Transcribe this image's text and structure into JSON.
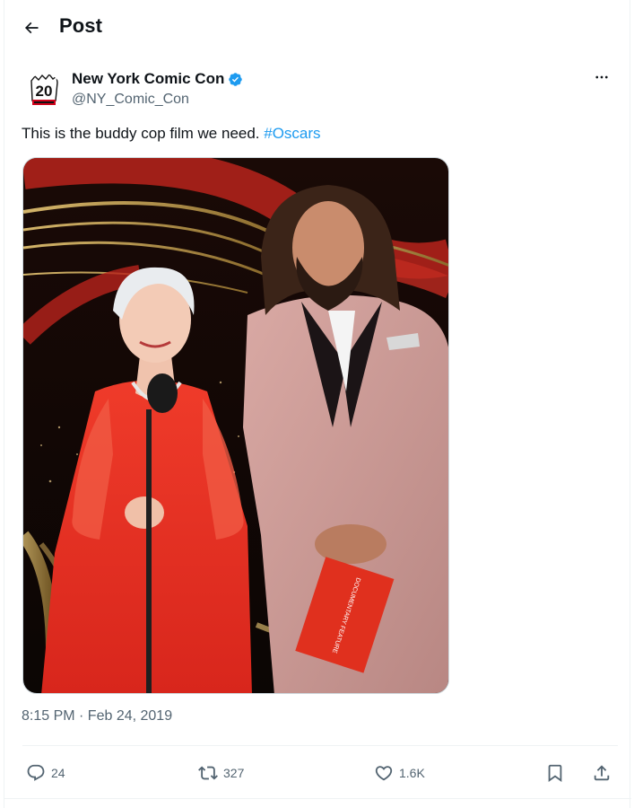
{
  "header": {
    "title": "Post",
    "back_icon": "arrow-left-icon"
  },
  "author": {
    "name": "New York Comic Con",
    "handle": "@NY_Comic_Con",
    "avatar_text": "20",
    "verified_color": "#1d9bf0"
  },
  "tweet": {
    "text": "This is the buddy cop film we need. ",
    "hashtag": "#Oscars",
    "timestamp": "8:15 PM · Feb 24, 2019",
    "envelope_text": "DOCUMENTARY FEATURE"
  },
  "actions": {
    "replies": "24",
    "reposts": "327",
    "likes": "1.6K"
  },
  "colors": {
    "accent": "#1d9bf0",
    "muted": "#536471",
    "text": "#0f1419"
  }
}
